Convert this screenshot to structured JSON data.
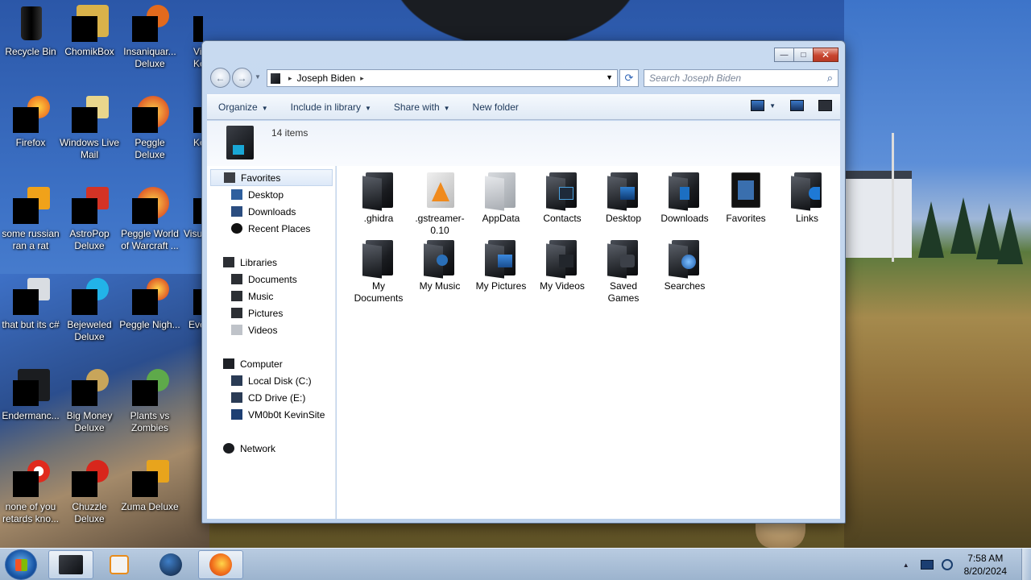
{
  "desktop": {
    "icons": [
      {
        "label": "Recycle Bin",
        "icon": "recycle-bin-icon"
      },
      {
        "label": "ChomikBox",
        "icon": "chomikbox-icon"
      },
      {
        "label": "Insaniquar... Deluxe",
        "icon": "insaniquarium-icon"
      },
      {
        "label": "Vi Ke",
        "icon": "app-icon"
      },
      {
        "label": "Firefox",
        "icon": "firefox-icon"
      },
      {
        "label": "Windows Live Mail",
        "icon": "mail-icon"
      },
      {
        "label": "Peggle Deluxe",
        "icon": "peggle-icon"
      },
      {
        "label": "Ke",
        "icon": "app-icon"
      },
      {
        "label": "some russian ran a rat",
        "icon": "file-icon"
      },
      {
        "label": "AstroPop Deluxe",
        "icon": "astropop-icon"
      },
      {
        "label": "Peggle World of Warcraft ...",
        "icon": "peggle-wow-icon"
      },
      {
        "label": "Visu",
        "icon": "app-icon"
      },
      {
        "label": "that but its c#",
        "icon": "file-icon"
      },
      {
        "label": "Bejeweled Deluxe",
        "icon": "bejeweled-icon"
      },
      {
        "label": "Peggle Nigh...",
        "icon": "peggle-nights-icon"
      },
      {
        "label": "Eve",
        "icon": "app-icon"
      },
      {
        "label": "Endermanc...",
        "icon": "app-icon"
      },
      {
        "label": "Big Money Deluxe",
        "icon": "big-money-icon"
      },
      {
        "label": "Plants vs Zombies",
        "icon": "pvz-icon"
      },
      {
        "label": "none of you retards kno...",
        "icon": "file-icon"
      },
      {
        "label": "Chuzzle Deluxe",
        "icon": "chuzzle-icon"
      },
      {
        "label": "Zuma Deluxe",
        "icon": "zuma-icon"
      }
    ]
  },
  "window": {
    "buttons": {
      "minimize": "—",
      "maximize": "□",
      "close": "✕"
    },
    "nav": {
      "back": "←",
      "forward": "→",
      "dropdown": "▼"
    },
    "address": {
      "crumb": "Joseph Biden",
      "sep": "▸",
      "dropdown": "▼",
      "refresh": "⟳"
    },
    "search": {
      "placeholder": "Search Joseph Biden",
      "icon": "⌕"
    },
    "toolbar": {
      "organize": "Organize",
      "include": "Include in library",
      "share": "Share with",
      "newfolder": "New folder",
      "caret": "▼"
    },
    "info": {
      "count": "14 items"
    },
    "sidebar": {
      "favorites": "Favorites",
      "desktop": "Desktop",
      "downloads": "Downloads",
      "recent": "Recent Places",
      "libraries": "Libraries",
      "documents": "Documents",
      "music": "Music",
      "pictures": "Pictures",
      "videos": "Videos",
      "computer": "Computer",
      "localdisk": "Local Disk (C:)",
      "cddrive": "CD Drive (E:)",
      "vm": "VM0b0t KevinSite",
      "network": "Network"
    },
    "files": [
      {
        "line1": ".ghidra",
        "line2": ""
      },
      {
        "line1": ".gstreamer-",
        "line2": "0.10"
      },
      {
        "line1": "AppData",
        "line2": ""
      },
      {
        "line1": "Contacts",
        "line2": ""
      },
      {
        "line1": "Desktop",
        "line2": ""
      },
      {
        "line1": "Downloads",
        "line2": ""
      },
      {
        "line1": "Favorites",
        "line2": ""
      },
      {
        "line1": "Links",
        "line2": ""
      },
      {
        "line1": "My",
        "line2": "Documents"
      },
      {
        "line1": "My Music",
        "line2": ""
      },
      {
        "line1": "My Pictures",
        "line2": ""
      },
      {
        "line1": "My Videos",
        "line2": ""
      },
      {
        "line1": "Saved",
        "line2": "Games"
      },
      {
        "line1": "Searches",
        "line2": ""
      }
    ]
  },
  "taskbar": {
    "tray_arrow": "▲",
    "time": "7:58 AM",
    "date": "8/20/2024"
  }
}
